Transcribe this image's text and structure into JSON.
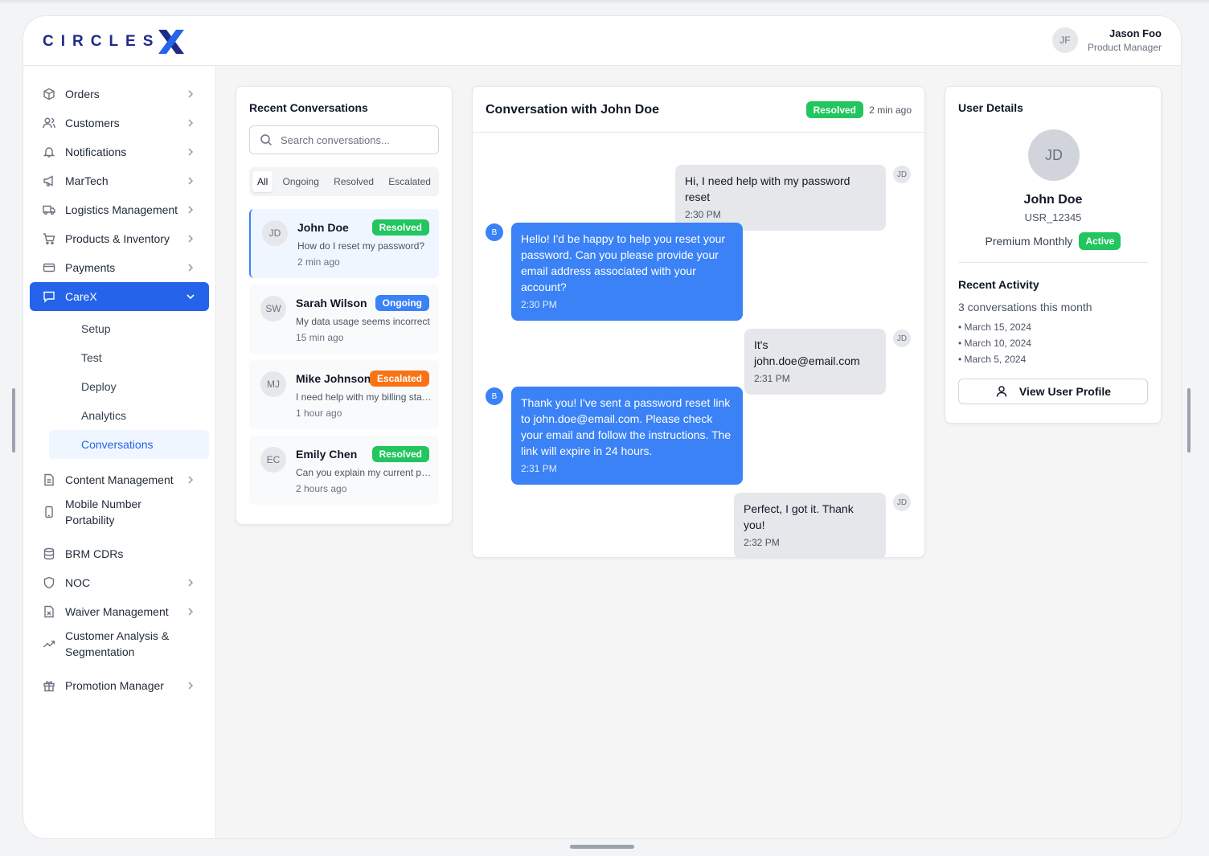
{
  "brand": {
    "logo_text": "CIRCLES",
    "logo_mark": "X"
  },
  "header": {
    "user_initials": "JF",
    "user_name": "Jason Foo",
    "user_role": "Product Manager"
  },
  "sidebar": {
    "items": [
      {
        "label": "Orders",
        "icon": "box-icon"
      },
      {
        "label": "Customers",
        "icon": "users-icon"
      },
      {
        "label": "Notifications",
        "icon": "bell-icon"
      },
      {
        "label": "MarTech",
        "icon": "megaphone-icon"
      },
      {
        "label": "Logistics Management",
        "icon": "truck-icon"
      },
      {
        "label": "Products & Inventory",
        "icon": "cart-icon"
      },
      {
        "label": "Payments",
        "icon": "credit-card-icon"
      },
      {
        "label": "CareX",
        "icon": "chat-icon"
      },
      {
        "label": "Content Management",
        "icon": "document-icon"
      },
      {
        "label": "Mobile Number Portability",
        "icon": "phone-icon"
      },
      {
        "label": "BRM CDRs",
        "icon": "database-icon"
      },
      {
        "label": "NOC",
        "icon": "shield-icon"
      },
      {
        "label": "Waiver Management",
        "icon": "file-x-icon"
      },
      {
        "label": "Customer Analysis & Segmentation",
        "icon": "trend-icon"
      },
      {
        "label": "Promotion Manager",
        "icon": "gift-icon"
      }
    ],
    "carex_sub": [
      "Setup",
      "Test",
      "Deploy",
      "Analytics",
      "Conversations"
    ]
  },
  "conversations": {
    "title": "Recent Conversations",
    "search_placeholder": "Search conversations...",
    "filters": [
      "All",
      "Ongoing",
      "Resolved",
      "Escalated"
    ],
    "items": [
      {
        "initials": "JD",
        "name": "John Doe",
        "status": "Resolved",
        "preview": "How do I reset my password?",
        "time": "2 min ago"
      },
      {
        "initials": "SW",
        "name": "Sarah Wilson",
        "status": "Ongoing",
        "preview": "My data usage seems incorrect",
        "time": "15 min ago"
      },
      {
        "initials": "MJ",
        "name": "Mike Johnson",
        "status": "Escalated",
        "preview": "I need help with my billing statement",
        "time": "1 hour ago"
      },
      {
        "initials": "EC",
        "name": "Emily Chen",
        "status": "Resolved",
        "preview": "Can you explain my current plan?",
        "time": "2 hours ago"
      }
    ]
  },
  "chat": {
    "title": "Conversation with John Doe",
    "status": "Resolved",
    "time": "2 min ago",
    "user_initials": "JD",
    "bot_initials": "B",
    "messages": [
      {
        "from": "user",
        "text": "Hi, I need help with my password reset",
        "time": "2:30 PM"
      },
      {
        "from": "bot",
        "text": "Hello! I'd be happy to help you reset your password. Can you please provide your email address associated with your account?",
        "time": "2:30 PM"
      },
      {
        "from": "user",
        "text": "It's john.doe@email.com",
        "time": "2:31 PM"
      },
      {
        "from": "bot",
        "text": "Thank you! I've sent a password reset link to john.doe@email.com. Please check your email and follow the instructions. The link will expire in 24 hours.",
        "time": "2:31 PM"
      },
      {
        "from": "user",
        "text": "Perfect, I got it. Thank you!",
        "time": "2:32 PM"
      }
    ]
  },
  "details": {
    "title": "User Details",
    "initials": "JD",
    "name": "John Doe",
    "user_id": "USR_12345",
    "plan": "Premium Monthly",
    "plan_status": "Active",
    "activity_title": "Recent Activity",
    "activity_summary": "3 conversations this month",
    "dates": [
      "• March 15, 2024",
      "• March 10, 2024",
      "• March 5, 2024"
    ],
    "profile_button": "View User Profile"
  },
  "colors": {
    "primary": "#2563eb",
    "resolved": "#22c55e",
    "ongoing": "#3b82f6",
    "escalated": "#f97316",
    "logo": "#1e2a8a"
  }
}
